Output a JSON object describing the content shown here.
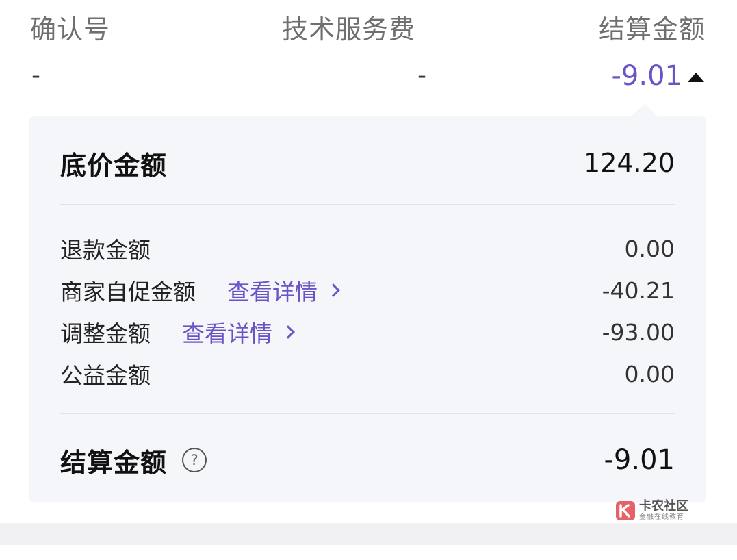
{
  "header": {
    "col1_title": "确认号",
    "col2_title": "技术服务费",
    "col3_title": "结算金额",
    "col1_value": "-",
    "col2_value": "-",
    "col3_value": "-9.01"
  },
  "breakdown": {
    "base_label": "底价金额",
    "base_value": "124.20",
    "items": [
      {
        "label": "退款金额",
        "value": "0.00"
      },
      {
        "label": "商家自促金额",
        "link": "查看详情",
        "value": "-40.21"
      },
      {
        "label": "调整金额",
        "link": "查看详情",
        "value": "-93.00"
      },
      {
        "label": "公益金额",
        "value": "0.00"
      }
    ],
    "total_label": "结算金额",
    "total_value": "-9.01"
  },
  "watermark": {
    "title": "卡农社区",
    "subtitle": "金融在线教育"
  },
  "colors": {
    "accent": "#6a53c6",
    "panel_bg": "#f5f6fa",
    "watermark_red": "#e0474f"
  },
  "icons": {
    "toggle": "caret-up-icon",
    "link_arrow": "chevron-right-icon",
    "help": "question-circle-icon"
  }
}
